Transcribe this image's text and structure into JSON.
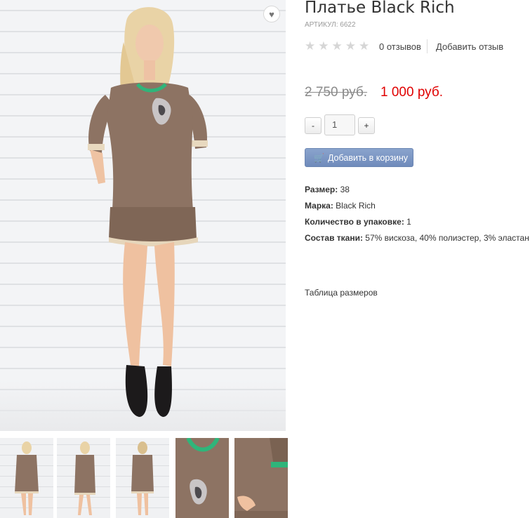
{
  "product": {
    "title": "Платье Black Rich",
    "sku": "АРТИКУЛ: 6622",
    "rating": 0,
    "reviews_count": "0 отзывов",
    "add_review": "Добавить отзыв",
    "price_old": "2 750 руб.",
    "price_new": "1 000 руб.",
    "qty_minus": "-",
    "qty_value": "1",
    "qty_plus": "+",
    "add_to_cart": "Добавить в корзину",
    "attributes": [
      {
        "label": "Размер:",
        "value": "38"
      },
      {
        "label": "Марка:",
        "value": "Black Rich"
      },
      {
        "label": "Количество в упаковке:",
        "value": "1"
      },
      {
        "label": "Состав ткани:",
        "value": "57% вискоза, 40% полиэстер, 3% эластан"
      }
    ],
    "size_table_link": "Таблица размеров"
  },
  "icons": {
    "wishlist": "heart-icon",
    "cart": "cart-icon",
    "star": "star-icon"
  },
  "colors": {
    "price_new": "#e00000",
    "price_old": "#8a8a8a",
    "cart_button": "#7a96c4",
    "dress": "#8d7363",
    "trim": "#2fb57a"
  },
  "thumbnails": [
    {
      "view": "front"
    },
    {
      "view": "side"
    },
    {
      "view": "back"
    },
    {
      "view": "detail-print"
    },
    {
      "view": "detail-sleeve"
    }
  ]
}
